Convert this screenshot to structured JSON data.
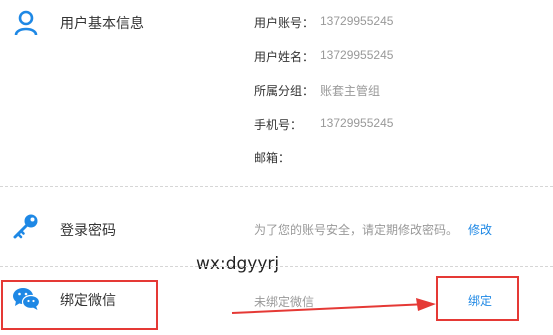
{
  "profile": {
    "title": "用户基本信息",
    "icon": "user-icon",
    "fields": [
      {
        "label": "用户账号：",
        "value": "13729955245"
      },
      {
        "label": "用户姓名：",
        "value": "13729955245"
      },
      {
        "label": "所属分组：",
        "value": "账套主管组"
      },
      {
        "label": "手机号：",
        "value": "13729955245"
      },
      {
        "label": "邮箱：",
        "value": ""
      }
    ]
  },
  "password": {
    "title": "登录密码",
    "icon": "key-icon",
    "hint": "为了您的账号安全，请定期修改密码。",
    "action": "修改"
  },
  "wechat": {
    "title": "绑定微信",
    "icon": "wechat-icon",
    "status": "未绑定微信",
    "action": "绑定"
  },
  "annotation": {
    "watermark": "wx:dgyyrj",
    "highlight_color": "#e53935"
  },
  "colors": {
    "accent": "#1e88e5",
    "muted": "#999999",
    "text": "#333333"
  }
}
